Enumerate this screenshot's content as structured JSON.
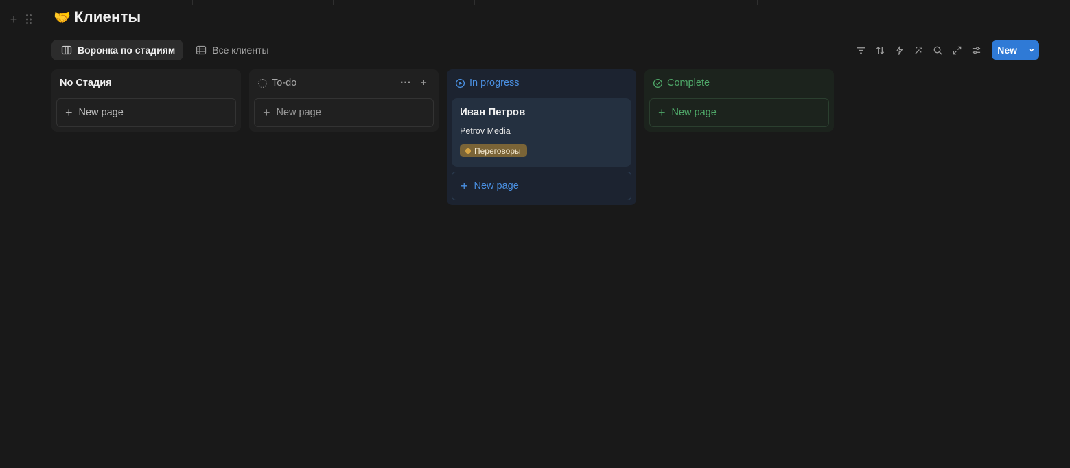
{
  "page": {
    "emoji": "🤝",
    "title": "Клиенты"
  },
  "views": [
    {
      "label": "Воронка по стадиям",
      "icon": "board-icon",
      "active": true
    },
    {
      "label": "Все клиенты",
      "icon": "table-icon",
      "active": false
    }
  ],
  "toolbar": {
    "new_label": "New"
  },
  "columns": [
    {
      "key": "nostage",
      "title": "No Стадия",
      "title_color": "#f0f0f0",
      "new_page_label": "New page"
    },
    {
      "key": "todo",
      "title": "To-do",
      "title_color": "#a8a8a8",
      "new_page_label": "New page"
    },
    {
      "key": "progress",
      "title": "In progress",
      "title_color": "#4a90e2",
      "new_page_label": "New page",
      "cards": [
        {
          "name": "Иван Петров",
          "company": "Petrov Media",
          "tag": "Переговоры"
        }
      ]
    },
    {
      "key": "complete",
      "title": "Complete",
      "title_color": "#4fa869",
      "new_page_label": "New page"
    }
  ],
  "colors": {
    "accent": "#2f7ad6",
    "background": "#191919"
  }
}
